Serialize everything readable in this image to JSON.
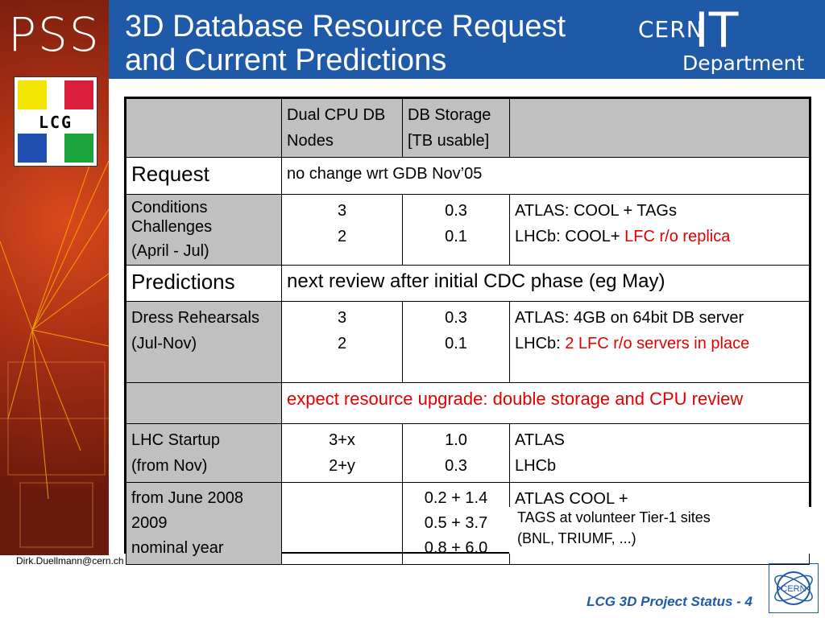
{
  "branding": {
    "pss_logo": "PSS",
    "lcg_logo": "LCG",
    "cern_logo_cern": "CERN",
    "cern_logo_it": "IT",
    "cern_logo_department": "Department",
    "seal_text": "CERN"
  },
  "header": {
    "title_line1": "3D Database Resource Request",
    "title_line2": "and Current Predictions"
  },
  "table": {
    "header": {
      "col2_line1": "Dual CPU DB",
      "col2_line2": "Nodes",
      "col3_line1": "DB Storage",
      "col3_line2": "[TB usable]"
    },
    "request_label": "Request",
    "request_text": "no change wrt GDB Nov’05",
    "conditions": {
      "label_line1": "Conditions",
      "label_line2": "Challenges",
      "label_line3": "(April - Jul)",
      "nodes": [
        "3",
        "2"
      ],
      "storage": [
        "0.3",
        "0.1"
      ],
      "atlas": "ATLAS: COOL + TAGs",
      "lhcb_prefix": "LHCb: COOL+ ",
      "lhcb_red": "LFC r/o replica"
    },
    "predictions_label": "Predictions",
    "predictions_text": "next review after initial CDC phase (eg May)",
    "dress": {
      "label_line1": "Dress Rehearsals",
      "label_line2": "(Jul-Nov)",
      "nodes": [
        "3",
        "2"
      ],
      "storage": [
        "0.3",
        "0.1"
      ],
      "atlas": "ATLAS: 4GB on 64bit DB server",
      "lhcb_prefix": "LHCb: ",
      "lhcb_red": "2 LFC r/o servers in place"
    },
    "expect_text": "expect resource upgrade: double storage and CPU review",
    "startup": {
      "label_line1": "LHC Startup",
      "label_line2": "(from Nov)",
      "nodes": [
        "3+x",
        "2+y"
      ],
      "storage": [
        "1.0",
        "0.3"
      ],
      "exp": [
        "ATLAS",
        "LHCb"
      ]
    },
    "future": {
      "labels": [
        "from June 2008",
        "2009",
        "nominal year"
      ],
      "storage": [
        "0.2 + 1.4",
        "0.5 + 3.7",
        "0.8 + 6.0"
      ],
      "atlas": "ATLAS COOL +",
      "tags_line1": "TAGS at volunteer Tier-1 sites",
      "tags_line2": "(BNL, TRIUMF, ...)"
    }
  },
  "footer": {
    "email": "Dirk.Duellmann@cern.ch",
    "project_status": "LCG 3D Project Status -   4"
  }
}
